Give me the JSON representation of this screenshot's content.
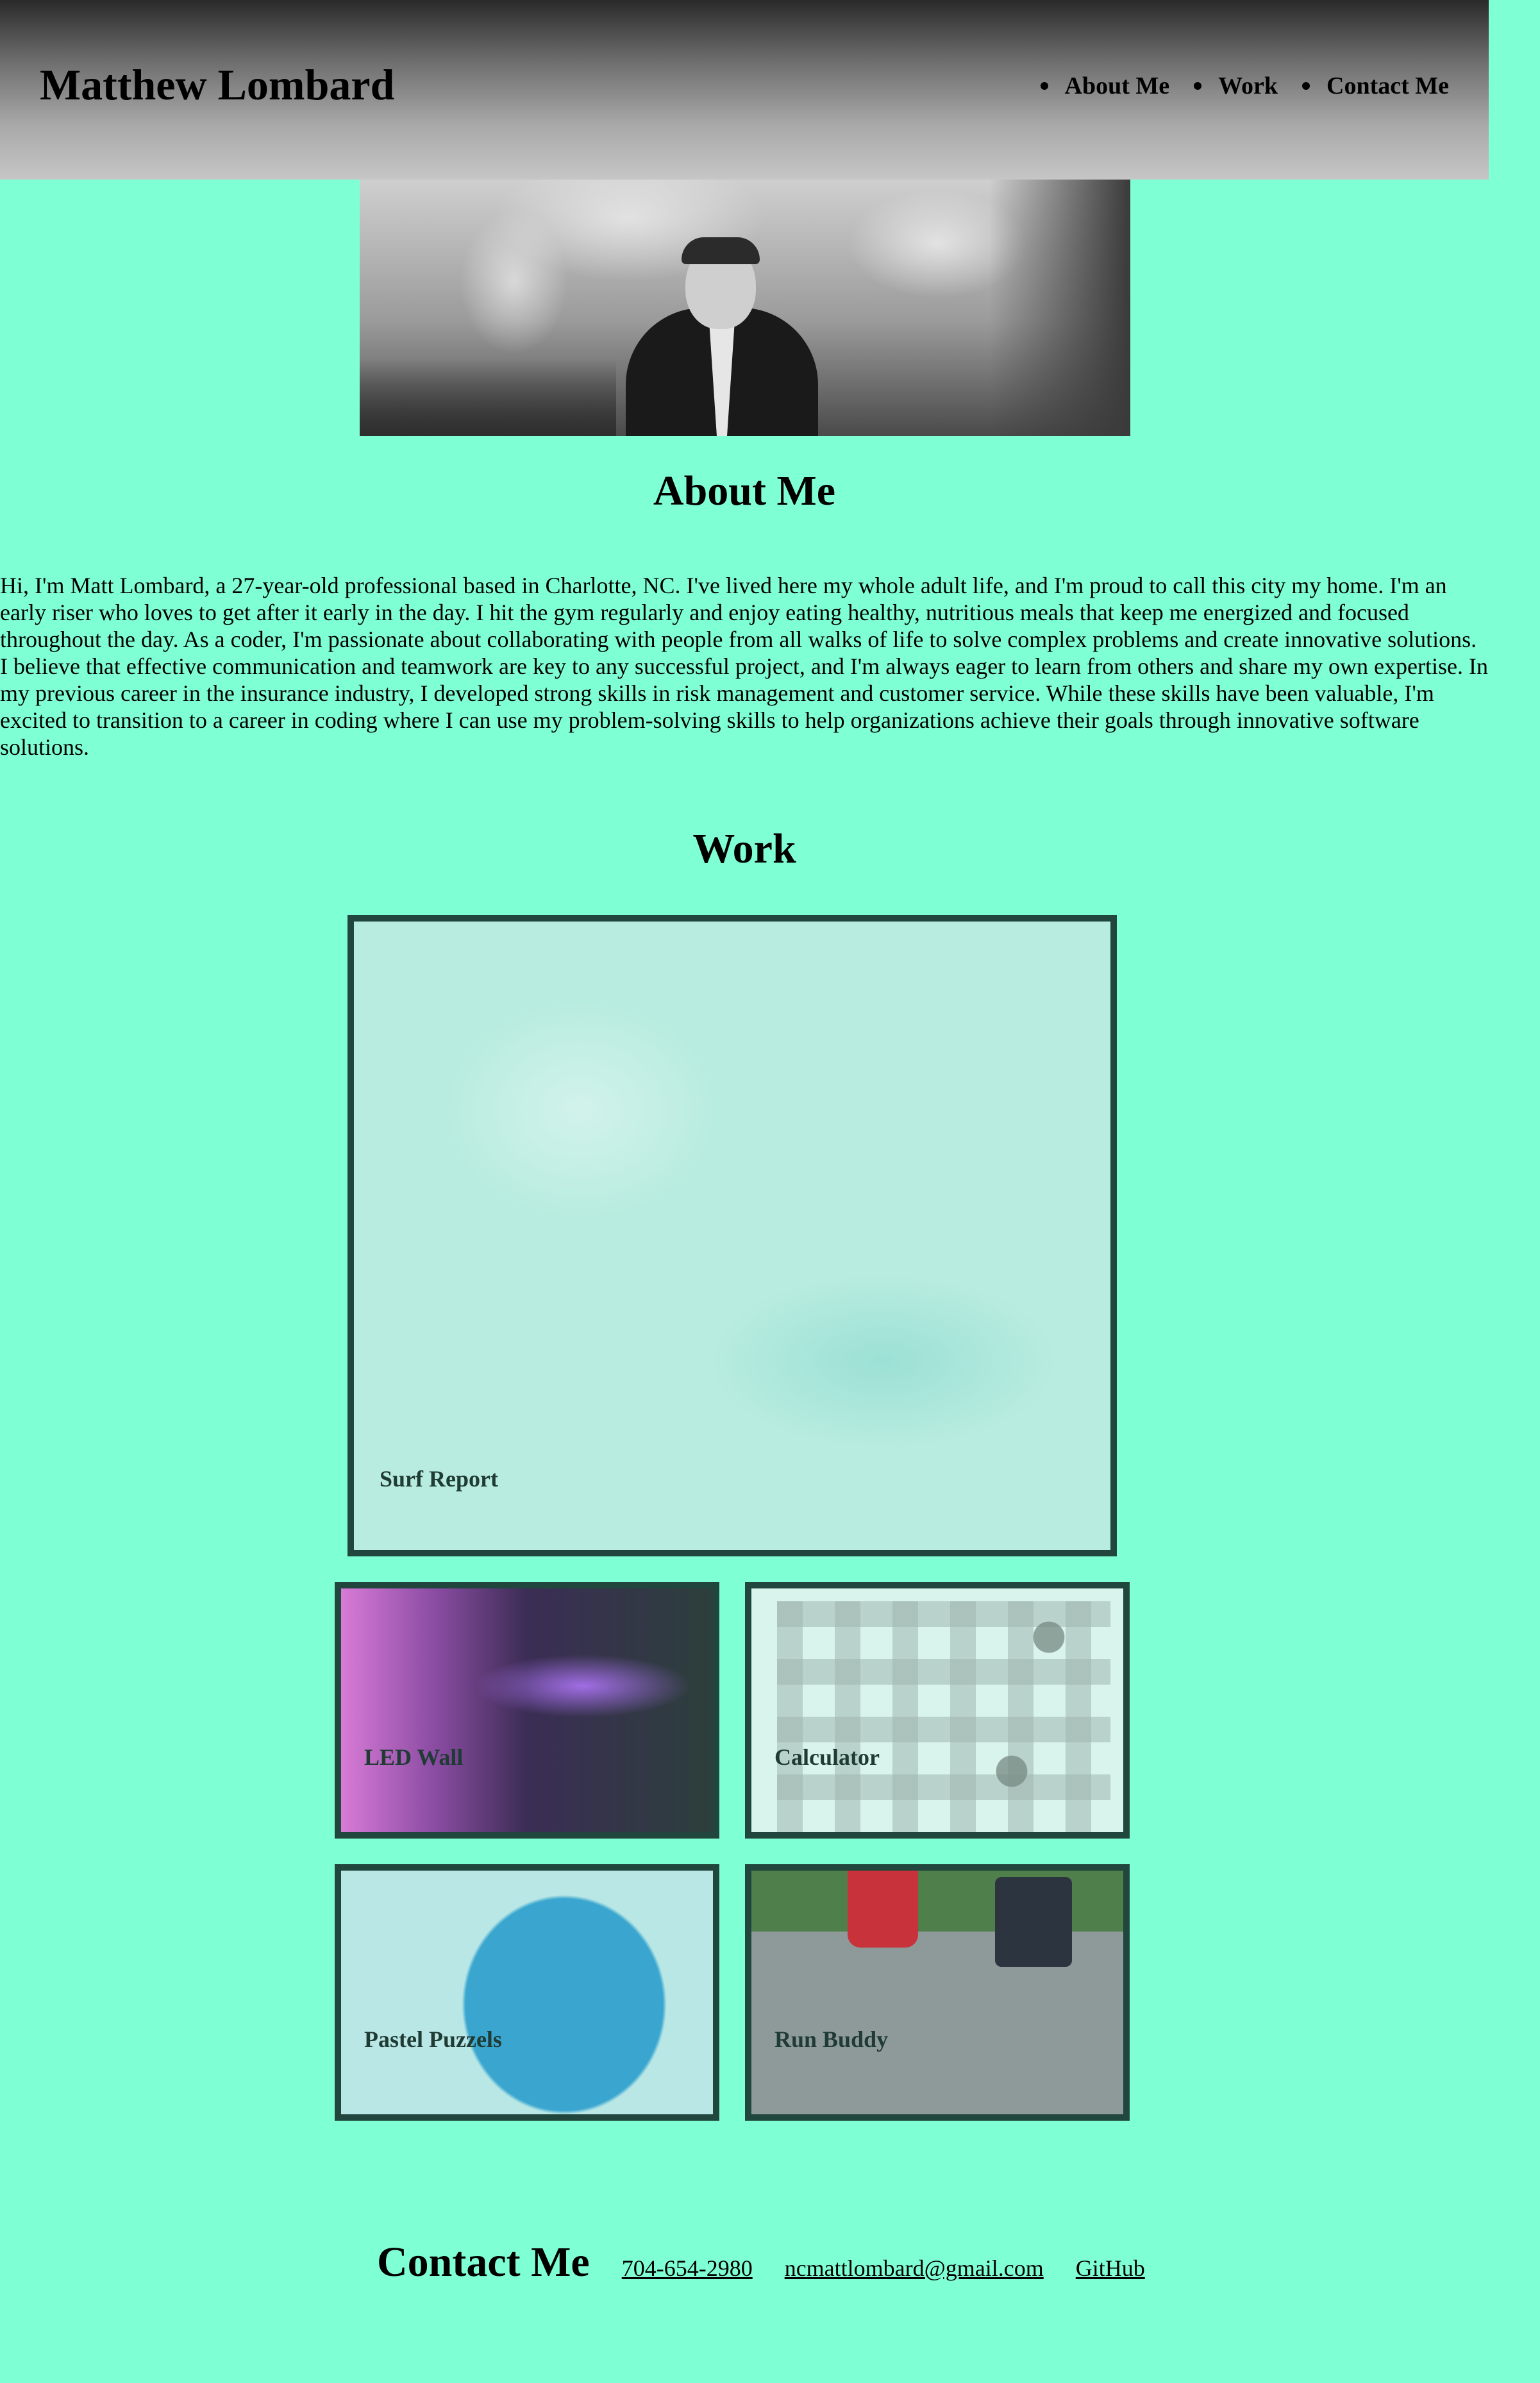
{
  "header": {
    "title": "Matthew Lombard",
    "nav": [
      {
        "label": "About Me"
      },
      {
        "label": "Work"
      },
      {
        "label": "Contact Me"
      }
    ]
  },
  "about": {
    "title": "About Me",
    "text": "Hi, I'm Matt Lombard, a 27-year-old professional based in Charlotte, NC. I've lived here my whole adult life, and I'm proud to call this city my home. I'm an early riser who loves to get after it early in the day. I hit the gym regularly and enjoy eating healthy, nutritious meals that keep me energized and focused throughout the day. As a coder, I'm passionate about collaborating with people from all walks of life to solve complex problems and create innovative solutions. I believe that effective communication and teamwork are key to any successful project, and I'm always eager to learn from others and share my own expertise. In my previous career in the insurance industry, I developed strong skills in risk management and customer service. While these skills have been valuable, I'm excited to transition to a career in coding where I can use my problem-solving skills to help organizations achieve their goals through innovative software solutions."
  },
  "work": {
    "title": "Work",
    "projects": [
      {
        "label": "Surf Report"
      },
      {
        "label": "LED Wall"
      },
      {
        "label": "Calculator"
      },
      {
        "label": "Pastel Puzzels"
      },
      {
        "label": "Run Buddy"
      }
    ]
  },
  "contact": {
    "title": "Contact Me",
    "phone": "704-654-2980",
    "email": "ncmattlombard@gmail.com",
    "github": "GitHub"
  },
  "colors": {
    "background": "#7fffd4",
    "card_border": "#20463d"
  }
}
